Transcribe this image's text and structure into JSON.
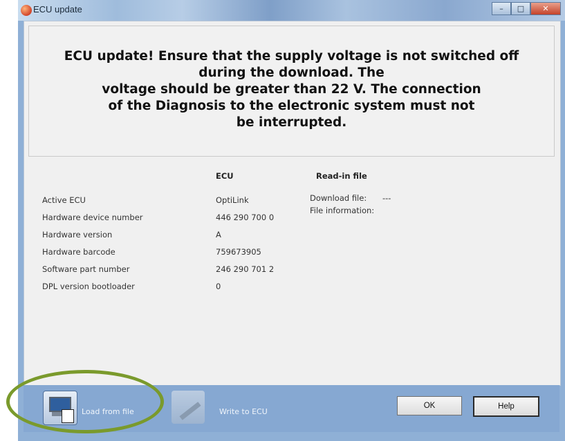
{
  "window": {
    "title": "ECU update",
    "controls": [
      "minimize",
      "maximize",
      "close"
    ]
  },
  "warning": {
    "lines": [
      "ECU update! Ensure that the supply voltage is not switched off",
      "during the download. The",
      "voltage should be greater than 22 V. The connection",
      "of the Diagnosis to the electronic system must not",
      "be interrupted."
    ]
  },
  "table": {
    "col_ecu": "ECU",
    "col_file": "Read-in file",
    "rows": [
      {
        "label": "Active ECU",
        "value": "OptiLink"
      },
      {
        "label": "Hardware device number",
        "value": "446 290 700 0"
      },
      {
        "label": "Hardware version",
        "value": "A"
      },
      {
        "label": "Hardware barcode",
        "value": "759673905"
      },
      {
        "label": "Software part number",
        "value": "246 290 701 2"
      },
      {
        "label": "DPL version bootloader",
        "value": "0"
      }
    ],
    "file": {
      "download_label": "Download file:",
      "download_value": "---",
      "info_label": "File information:"
    }
  },
  "toolbar": {
    "read_label": "Load from file",
    "write_label": "Write to ECU",
    "ok_label": "OK",
    "help_label": "Help"
  },
  "colors": {
    "toolbar_bg": "#86a8d2",
    "highlight": "#7a9a2c"
  }
}
